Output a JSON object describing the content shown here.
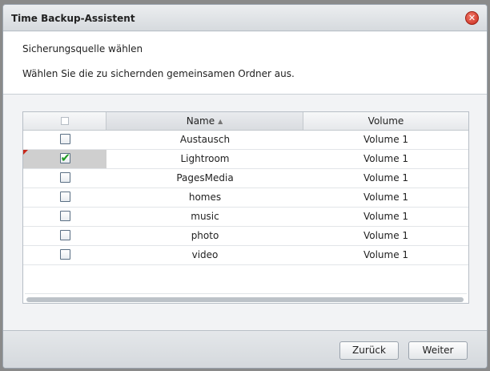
{
  "window": {
    "title": "Time Backup-Assistent",
    "close_icon": "close-icon"
  },
  "step": {
    "title": "Sicherungsquelle wählen",
    "description": "Wählen Sie die zu sichernden gemeinsamen Ordner aus."
  },
  "grid": {
    "columns": {
      "name": "Name",
      "volume": "Volume",
      "sort_indicator": "▲"
    },
    "header_checkbox_checked": false,
    "rows": [
      {
        "name": "Austausch",
        "volume": "Volume 1",
        "checked": false
      },
      {
        "name": "Lightroom",
        "volume": "Volume 1",
        "checked": true
      },
      {
        "name": "PagesMedia",
        "volume": "Volume 1",
        "checked": false
      },
      {
        "name": "homes",
        "volume": "Volume 1",
        "checked": false
      },
      {
        "name": "music",
        "volume": "Volume 1",
        "checked": false
      },
      {
        "name": "photo",
        "volume": "Volume 1",
        "checked": false
      },
      {
        "name": "video",
        "volume": "Volume 1",
        "checked": false
      }
    ]
  },
  "footer": {
    "back_label": "Zurück",
    "next_label": "Weiter"
  },
  "colors": {
    "dirty_marker": "#c8281a",
    "check_green": "#1f9a23",
    "selected_cell": "#cfcfcf"
  }
}
